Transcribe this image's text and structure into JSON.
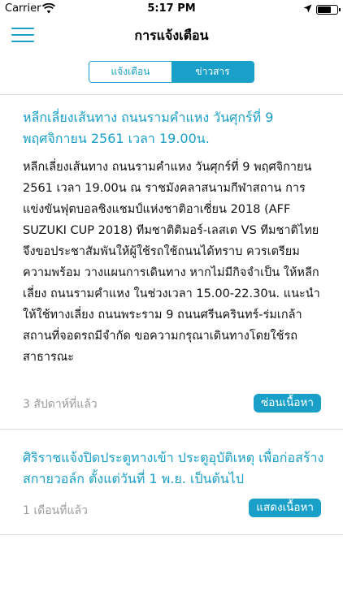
{
  "status_bar": {
    "carrier": "Carrier",
    "time": "5:17 PM",
    "icons": [
      "wifi-icon",
      "location-arrow-icon",
      "battery-icon"
    ]
  },
  "nav": {
    "title": "การแจ้งเตือน",
    "menu_icon": "hamburger-menu-icon"
  },
  "tabs": [
    {
      "label": "แจ้งเตือน",
      "selected": false
    },
    {
      "label": "ข่าวสาร",
      "selected": true
    }
  ],
  "news": [
    {
      "title": "หลีกเลี่ยงเส้นทาง ถนนรามคำแหง วันศุกร์ที่ 9 พฤศจิกายน 2561 เวลา 19.00น.",
      "body": "หลีกเลี่ยงเส้นทาง ถนนรามคำแหง วันศุกร์ที่ 9 พฤศจิกายน 2561 เวลา 19.00น ณ ราชมังคลาสนามกีฬาสถาน การแข่งขันฟุตบอลชิงแชมป์แห่งชาติอาเซี่ยน 2018 (AFF SUZUKI CUP 2018) ทีมชาติติมอร์-เลสเต VS ทีมชาติไทย จึงขอประชาสัมพันให้ผู้ใช้รถใช้ถนนได้ทราบ ควรเตรียมความพร้อม วางแผนการเดินทาง หากไม่มีกิจจำเป็น ให้หลีกเลี่ยง ถนนรามคำแหง ในช่วงเวลา 15.00-22.30น. แนะนำให้ใช้ทางเลี่ยง ถนนพระราม 9 ถนนศรีนครินทร์-ร่มเกล้า สถานที่จอดรถมีจำกัด ขอความกรุณาเดินทางโดยใช้รถสาธารณะ",
      "time": "3 สัปดาห์ที่แล้ว",
      "button": "ซ่อนเนื้อหา",
      "expanded": true
    },
    {
      "title": "ศิริราชแจ้งปิดประตูทางเข้า ประตูอุบัติเหตุ เพื่อก่อสร้างสกายวอล์ก ตั้งแต่วันที่ 1 พ.ย. เป็นต้นไป",
      "time": "1 เดือนที่แล้ว",
      "button": "แสดงเนื้อหา",
      "expanded": false
    }
  ],
  "colors": {
    "accent": "#1aa0c8",
    "muted_text": "#9a9a9a",
    "divider": "#dcdcdc"
  }
}
